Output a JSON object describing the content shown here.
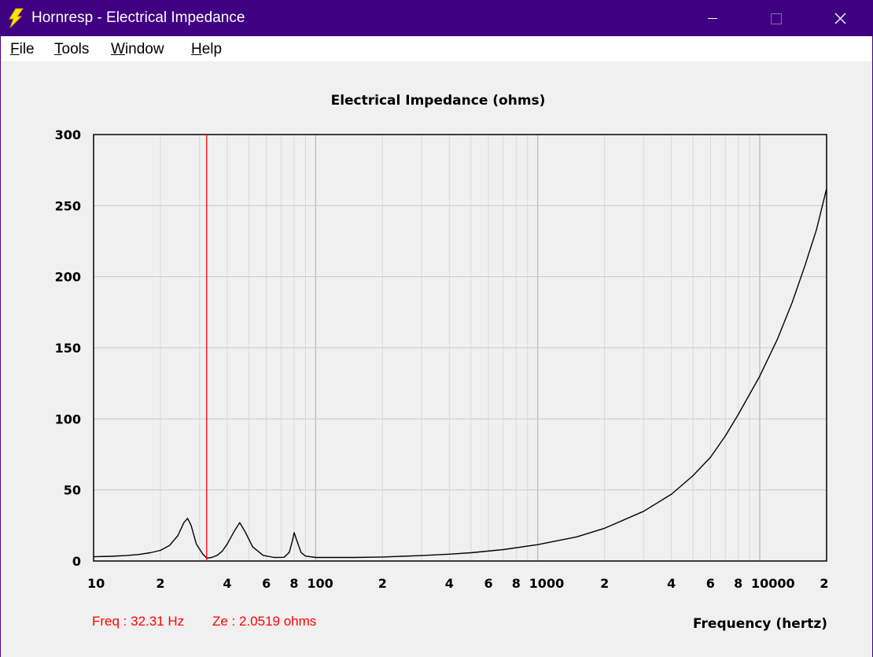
{
  "window": {
    "title": "Hornresp - Electrical Impedance",
    "title_bar_color": "#3f0082",
    "icon": "lightning-bolt-icon",
    "controls": [
      "minimize-icon",
      "maximize-icon",
      "close-icon"
    ]
  },
  "menu": {
    "items": [
      {
        "label": "File",
        "underline": "F"
      },
      {
        "label": "Tools",
        "underline": "T"
      },
      {
        "label": "Window",
        "underline": "W"
      },
      {
        "label": "Help",
        "underline": "H"
      }
    ]
  },
  "readout": {
    "freq": "Freq : 32.31 Hz",
    "ze": "Ze : 2.0519 ohms",
    "color": "#ff0000"
  },
  "chart_data": {
    "type": "line",
    "title": "Electrical Impedance (ohms)",
    "xlabel": "Frequency (hertz)",
    "ylabel": "",
    "x_scale": "log",
    "xlim": [
      10,
      20000
    ],
    "ylim": [
      0,
      300
    ],
    "grid": true,
    "y_ticks": [
      0,
      50,
      100,
      150,
      200,
      250,
      300
    ],
    "x_ticks": [
      {
        "value": 10,
        "label": "10"
      },
      {
        "value": 20,
        "label": "2"
      },
      {
        "value": 40,
        "label": "4"
      },
      {
        "value": 60,
        "label": "6"
      },
      {
        "value": 80,
        "label": "8"
      },
      {
        "value": 100,
        "label": "100"
      },
      {
        "value": 200,
        "label": "2"
      },
      {
        "value": 400,
        "label": "4"
      },
      {
        "value": 600,
        "label": "6"
      },
      {
        "value": 800,
        "label": "8"
      },
      {
        "value": 1000,
        "label": "1000"
      },
      {
        "value": 2000,
        "label": "2"
      },
      {
        "value": 4000,
        "label": "4"
      },
      {
        "value": 6000,
        "label": "6"
      },
      {
        "value": 8000,
        "label": "8"
      },
      {
        "value": 10000,
        "label": "10000"
      },
      {
        "value": 20000,
        "label": "2"
      }
    ],
    "cursor": {
      "x": 32.31,
      "color": "#ff0000"
    },
    "series": [
      {
        "color": "#000000",
        "points": [
          [
            10,
            3.0
          ],
          [
            12,
            3.3
          ],
          [
            14,
            3.8
          ],
          [
            16,
            4.6
          ],
          [
            18,
            5.8
          ],
          [
            20,
            7.5
          ],
          [
            22,
            11
          ],
          [
            24,
            18
          ],
          [
            25.5,
            27
          ],
          [
            26.5,
            30
          ],
          [
            27.5,
            25
          ],
          [
            29,
            12
          ],
          [
            31,
            5
          ],
          [
            32.31,
            2.05
          ],
          [
            34,
            2.5
          ],
          [
            36,
            4
          ],
          [
            38,
            7
          ],
          [
            40,
            12
          ],
          [
            43,
            21
          ],
          [
            45.5,
            27
          ],
          [
            48,
            21
          ],
          [
            52,
            10
          ],
          [
            58,
            4
          ],
          [
            65,
            2.5
          ],
          [
            72,
            2.6
          ],
          [
            76,
            6
          ],
          [
            78.5,
            14
          ],
          [
            80,
            20
          ],
          [
            82,
            15
          ],
          [
            86,
            6
          ],
          [
            90,
            3.5
          ],
          [
            100,
            2.5
          ],
          [
            150,
            2.5
          ],
          [
            200,
            2.8
          ],
          [
            300,
            3.8
          ],
          [
            400,
            4.8
          ],
          [
            500,
            5.8
          ],
          [
            700,
            8
          ],
          [
            1000,
            11.5
          ],
          [
            1500,
            17
          ],
          [
            2000,
            23
          ],
          [
            3000,
            35
          ],
          [
            4000,
            47
          ],
          [
            5000,
            60
          ],
          [
            6000,
            73
          ],
          [
            7000,
            88
          ],
          [
            8000,
            103
          ],
          [
            10000,
            130
          ],
          [
            12000,
            156
          ],
          [
            14000,
            182
          ],
          [
            16000,
            208
          ],
          [
            18000,
            233
          ],
          [
            20000,
            262
          ]
        ]
      }
    ]
  }
}
